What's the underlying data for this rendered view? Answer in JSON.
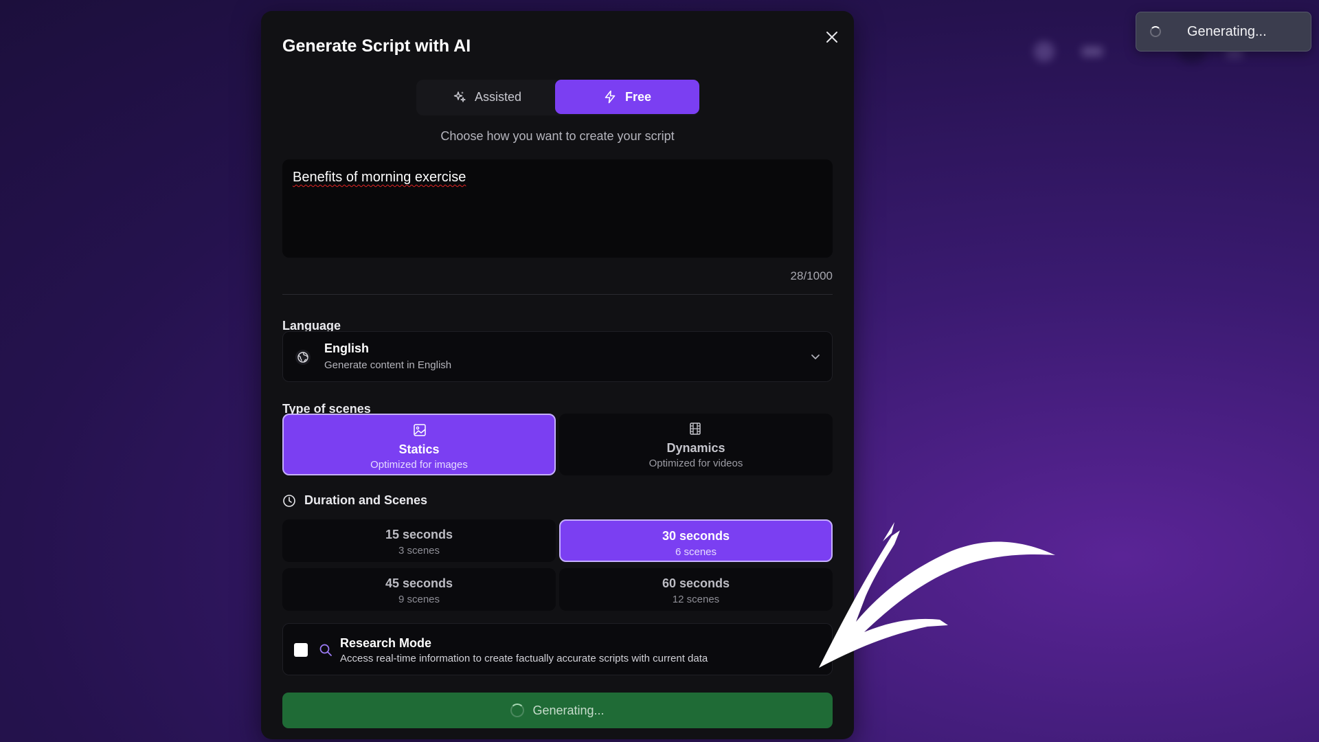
{
  "toast": {
    "text": "Generating..."
  },
  "modal": {
    "title": "Generate Script with AI",
    "mode_toggle": {
      "assisted_label": "Assisted",
      "free_label": "Free",
      "selected": "Free"
    },
    "subtitle": "Choose how you want to create your script",
    "prompt": {
      "value": "Benefits of morning exercise",
      "char_count": "28/1000"
    },
    "language": {
      "label": "Language",
      "selected_name": "English",
      "selected_desc": "Generate content in English"
    },
    "scene_types": {
      "label": "Type of scenes",
      "options": [
        {
          "title": "Statics",
          "subtitle": "Optimized for images",
          "icon": "image-icon",
          "selected": true
        },
        {
          "title": "Dynamics",
          "subtitle": "Optimized for videos",
          "icon": "film-icon",
          "selected": false
        }
      ]
    },
    "duration": {
      "label": "Duration and Scenes",
      "options": [
        {
          "title": "15 seconds",
          "subtitle": "3 scenes",
          "selected": false
        },
        {
          "title": "30 seconds",
          "subtitle": "6 scenes",
          "selected": true
        },
        {
          "title": "45 seconds",
          "subtitle": "9 scenes",
          "selected": false
        },
        {
          "title": "60 seconds",
          "subtitle": "12 scenes",
          "selected": false
        }
      ]
    },
    "research": {
      "title": "Research Mode",
      "description": "Access real-time information to create factually accurate scripts with current data",
      "checked": false
    },
    "generate_button": {
      "label": "Generating..."
    }
  },
  "colors": {
    "accent": "#7b3ff2",
    "modal_bg": "#111114",
    "generate_green": "#1f6b36"
  }
}
